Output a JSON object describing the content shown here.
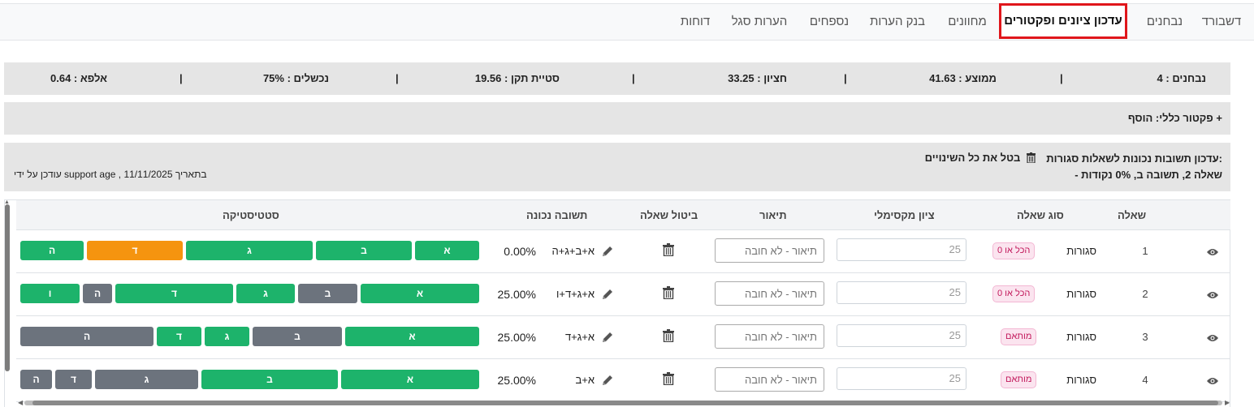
{
  "nav": {
    "items": [
      {
        "label": "דשבורד"
      },
      {
        "label": "נבחנים"
      },
      {
        "label": "עדכון ציונים ופקטורים",
        "active": true
      },
      {
        "label": "מחוונים"
      },
      {
        "label": "בנק הערות"
      },
      {
        "label": "נספחים"
      },
      {
        "label": "הערות סגל"
      },
      {
        "label": "דוחות"
      }
    ]
  },
  "summary": {
    "examinees": "נבחנים : 4",
    "average": "ממוצע : 41.63",
    "median": "חציון : 33.25",
    "std": "סטיית תקן : 19.56",
    "failed": "נכשלים : 75%",
    "alpha": "אלפא : 0.64",
    "separator": "|"
  },
  "factor": {
    "label": "פקטור כללי: הוסף +"
  },
  "update": {
    "title": "עדכון תשובות נכונות לשאלות סגורות:",
    "cancel_all": "בטל את כל השינויים",
    "detail": "- שאלה 2, תשובה ב, 0% נקודות",
    "updated_by": "עודכן על ידי support age , בתאריך 11/11/2025"
  },
  "table": {
    "headers": {
      "question": "שאלה",
      "type": "סוג שאלה",
      "max_grade": "ציון מקסימלי",
      "description": "תיאור",
      "cancel_question": "ביטול שאלה",
      "correct_answer": "תשובה נכונה",
      "statistics": "סטטיסטיקה"
    },
    "rows": [
      {
        "num": "1",
        "type": "סגורות",
        "badge": "הכל או 0",
        "max_grade_placeholder": "25",
        "desc_placeholder": "תיאור - לא חובה",
        "answer": "א+ב+ג+ה",
        "percent": "0.00%",
        "stats": [
          {
            "label": "א",
            "color": "#1db36b"
          },
          {
            "label": "ב",
            "color": "#1db36b"
          },
          {
            "label": "ג",
            "color": "#1db36b"
          },
          {
            "label": "ד",
            "color": "#f5940f"
          },
          {
            "label": "ה",
            "color": "#1db36b"
          }
        ]
      },
      {
        "num": "2",
        "type": "סגורות",
        "badge": "הכל או 0",
        "max_grade_placeholder": "25",
        "desc_placeholder": "תיאור - לא חובה",
        "answer": "א+ג+ד+ו",
        "percent": "25.00%",
        "stats": [
          {
            "label": "א",
            "color": "#1db36b"
          },
          {
            "label": "ב",
            "color": "#6c737d"
          },
          {
            "label": "ג",
            "color": "#1db36b"
          },
          {
            "label": "ד",
            "color": "#1db36b"
          },
          {
            "label": "ה",
            "color": "#6c737d"
          },
          {
            "label": "ו",
            "color": "#1db36b"
          }
        ]
      },
      {
        "num": "3",
        "type": "סגורות",
        "badge": "מותאם",
        "max_grade_placeholder": "25",
        "desc_placeholder": "תיאור - לא חובה",
        "answer": "א+ג+ד",
        "percent": "25.00%",
        "stats": [
          {
            "label": "א",
            "color": "#1db36b"
          },
          {
            "label": "ב",
            "color": "#6c737d"
          },
          {
            "label": "ג",
            "color": "#1db36b"
          },
          {
            "label": "ד",
            "color": "#1db36b"
          },
          {
            "label": "ה",
            "color": "#6c737d"
          }
        ]
      },
      {
        "num": "4",
        "type": "סגורות",
        "badge": "מותאם",
        "max_grade_placeholder": "25",
        "desc_placeholder": "תיאור - לא חובה",
        "answer": "א+ב",
        "percent": "25.00%",
        "stats": [
          {
            "label": "א",
            "color": "#1db36b"
          },
          {
            "label": "ב",
            "color": "#1db36b"
          },
          {
            "label": "ג",
            "color": "#6c737d"
          },
          {
            "label": "ד",
            "color": "#6c737d"
          },
          {
            "label": "ה",
            "color": "#6c737d"
          }
        ]
      }
    ]
  },
  "icons": {
    "view": "eye-icon",
    "delete": "trash-icon",
    "edit": "pencil-icon"
  }
}
